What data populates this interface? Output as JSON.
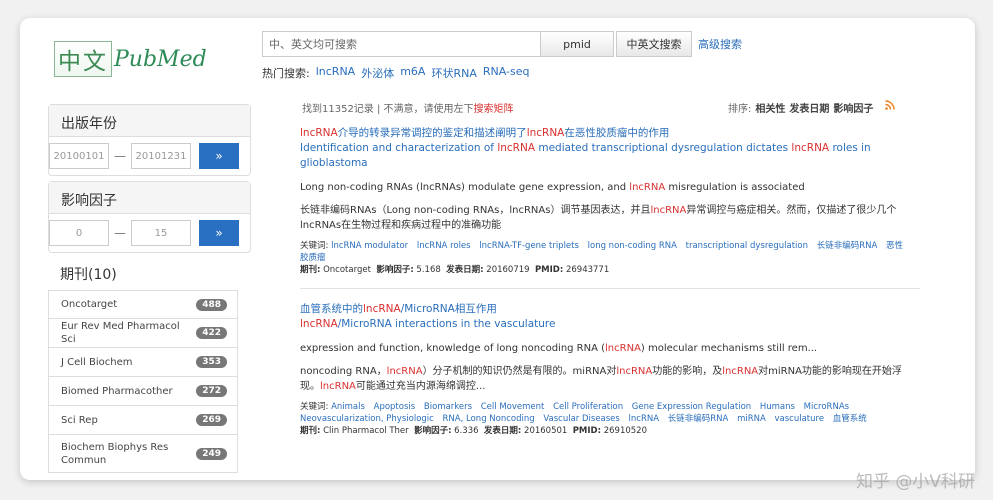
{
  "logo": {
    "cn": "中文",
    "en": "PubMed"
  },
  "search": {
    "placeholder": "中、英文均可搜索",
    "pmid_label": "pmid",
    "bilingual_label": "中英文搜索",
    "advanced_label": "高级搜索"
  },
  "hot": {
    "label": "热门搜索:",
    "keywords": [
      "lncRNA",
      "外泌体",
      "m6A",
      "环状RNA",
      "RNA-seq"
    ]
  },
  "filters": {
    "year": {
      "title": "出版年份",
      "from": "20100101",
      "to": "20101231",
      "dash": "—",
      "go": "»"
    },
    "impact": {
      "title": "影响因子",
      "from": "0",
      "to": "15",
      "dash": "—",
      "go": "»"
    },
    "journals_title": "期刊(10)",
    "journals": [
      {
        "name": "Oncotarget",
        "count": "488"
      },
      {
        "name": "Eur Rev Med Pharmacol Sci",
        "count": "422"
      },
      {
        "name": "J Cell Biochem",
        "count": "353"
      },
      {
        "name": "Biomed Pharmacother",
        "count": "272"
      },
      {
        "name": "Sci Rep",
        "count": "269"
      },
      {
        "name": "Biochem Biophys Res Commun",
        "count": "249"
      }
    ]
  },
  "results_meta": {
    "found": "找到11352记录 | 不满意，请使用左下",
    "matrix_link": "搜索矩阵",
    "sort_label": "排序:",
    "sort_options": [
      "相关性",
      "发表日期",
      "影响因子"
    ],
    "rss_icon": "rss-icon"
  },
  "results": [
    {
      "title_zh_parts": [
        "",
        "lncRNA",
        "介导的转录异常调控的鉴定和描述阐明了",
        "lncRNA",
        "在恶性胶质瘤中的作用"
      ],
      "title_en_parts": [
        "Identification and characterization of ",
        "lncRNA",
        " mediated transcriptional dysregulation dictates ",
        "lncRNA",
        " roles in glioblastoma"
      ],
      "abstract_parts": [
        "Long non-coding RNAs (lncRNAs) modulate gene expression, and ",
        "lncRNA",
        " misregulation is associated"
      ],
      "abstract_zh_parts": [
        "长链非编码RNAs（Long non-coding RNAs，lncRNAs）调节基因表达，并且",
        "lncRNA",
        "异常调控与癌症相关。然而，仅描述了很少几个lncRNAs在生物过程和疾病过程中的准确功能"
      ],
      "keywords_label": "关键词:",
      "keywords": [
        "lncRNA modulator",
        "lncRNA roles",
        "lncRNA-TF-gene triplets",
        "long non-coding RNA",
        "transcriptional dysregulation",
        "长链非编码RNA",
        "恶性胶质瘤"
      ],
      "journal_label": "期刊:",
      "journal": "Oncotarget",
      "if_label": "影响因子:",
      "if": "5.168",
      "date_label": "发表日期:",
      "date": "20160719",
      "pmid_label": "PMID:",
      "pmid": "26943771"
    },
    {
      "title_zh_parts": [
        "血管系统中的",
        "lncRNA",
        "/MicroRNA相互作用"
      ],
      "title_en_parts": [
        "",
        "lncRNA",
        "/MicroRNA interactions in the vasculature"
      ],
      "abstract_parts": [
        "expression and function, knowledge of long noncoding RNA (",
        "lncRNA",
        ") molecular mechanisms still rem..."
      ],
      "abstract_zh_parts": [
        "noncoding RNA，",
        "lncRNA",
        "）分子机制的知识仍然是有限的。miRNA对",
        "lncRNA",
        "功能的影响，及",
        "lncRNA",
        "对miRNA功能的影响现在开始浮现。",
        "lncRNA",
        "可能通过充当内源海绵调控..."
      ],
      "keywords_label": "关键词:",
      "keywords": [
        "Animals",
        "Apoptosis",
        "Biomarkers",
        "Cell Movement",
        "Cell Proliferation",
        "Gene Expression Regulation",
        "Humans",
        "MicroRNAs",
        "Neovascularization, Physiologic",
        "RNA, Long Noncoding",
        "Vascular Diseases",
        "lncRNA",
        "长链非编码RNA",
        "miRNA",
        "vasculature",
        "血管系统"
      ],
      "journal_label": "期刊:",
      "journal": "Clin Pharmacol Ther",
      "if_label": "影响因子:",
      "if": "6.336",
      "date_label": "发表日期:",
      "date": "20160501",
      "pmid_label": "PMID:",
      "pmid": "26910520"
    }
  ],
  "watermark": "知乎 @小V科研"
}
